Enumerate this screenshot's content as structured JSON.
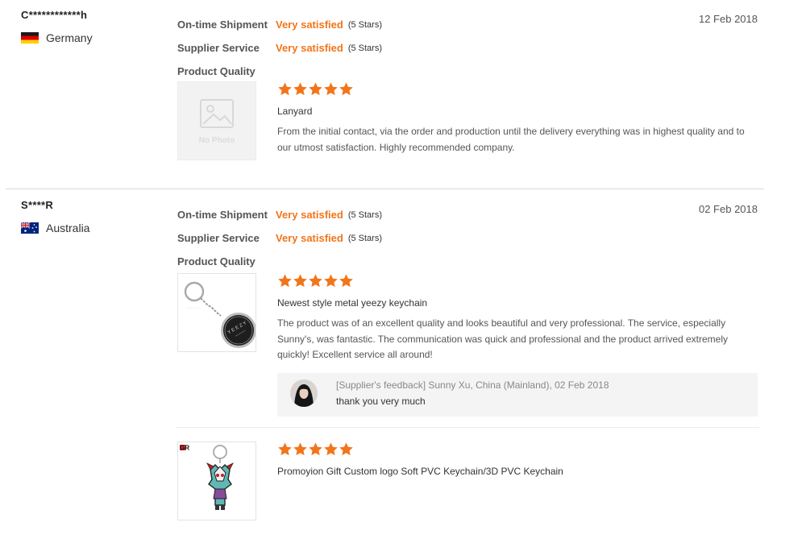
{
  "reviews": [
    {
      "buyer": "C************h",
      "country": "Germany",
      "date": "12 Feb 2018",
      "ratings": [
        {
          "label": "On-time Shipment",
          "value": "Very satisfied",
          "stars": "(5 Stars)"
        },
        {
          "label": "Supplier Service",
          "value": "Very satisfied",
          "stars": "(5 Stars)"
        },
        {
          "label": "Product Quality"
        }
      ],
      "products": [
        {
          "image_placeholder": "No Photo",
          "rating": 5,
          "name": "Lanyard",
          "text": "From the initial contact, via the order and production until the delivery everything was in highest quality and to our utmost satisfaction. Highly recommended company."
        }
      ]
    },
    {
      "buyer": "S****R",
      "country": "Australia",
      "date": "02 Feb 2018",
      "ratings": [
        {
          "label": "On-time Shipment",
          "value": "Very satisfied",
          "stars": "(5 Stars)"
        },
        {
          "label": "Supplier Service",
          "value": "Very satisfied",
          "stars": "(5 Stars)"
        },
        {
          "label": "Product Quality"
        }
      ],
      "products": [
        {
          "rating": 5,
          "name": "Newest style metal yeezy keychain",
          "text": "The product was of an excellent quality and looks beautiful and very professional. The service, especially Sunny's, was fantastic. The communication was quick and professional and the product arrived extremely quickly! Excellent service all around!",
          "feedback": {
            "meta": "[Supplier's feedback] Sunny Xu, China (Mainland), 02 Feb 2018",
            "text": "thank you very much"
          }
        },
        {
          "image_logo_text": "GR",
          "rating": 5,
          "name": "Promoyion Gift Custom logo Soft PVC Keychain/3D PVC Keychain"
        }
      ]
    }
  ],
  "colors": {
    "accent": "#f2751a",
    "star": "#f2751a",
    "label": "#555555",
    "feedback_bg": "#f4f4f4"
  },
  "icons": [
    "flag-germany-icon",
    "flag-australia-icon",
    "star-icon",
    "no-photo-icon",
    "avatar"
  ]
}
